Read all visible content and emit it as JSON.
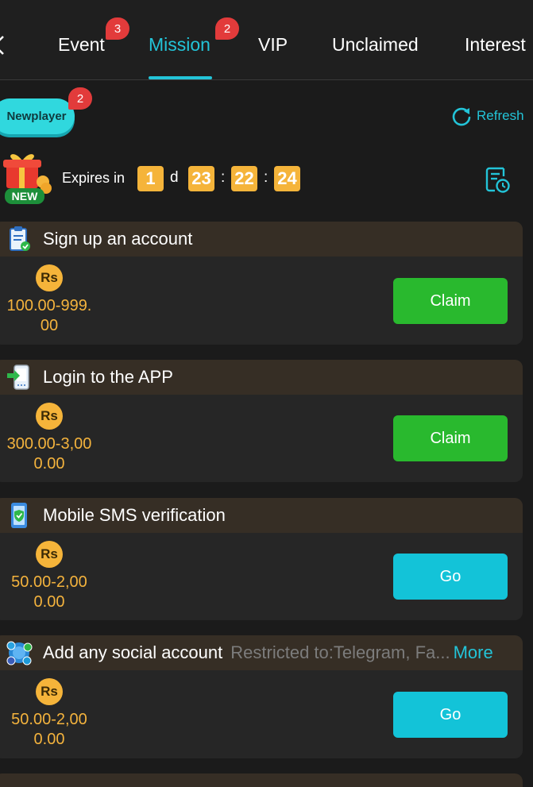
{
  "tabs": [
    {
      "label": "Event",
      "badge": "3",
      "active": false
    },
    {
      "label": "Mission",
      "badge": "2",
      "active": true
    },
    {
      "label": "VIP",
      "badge": "",
      "active": false
    },
    {
      "label": "Unclaimed",
      "badge": "",
      "active": false
    },
    {
      "label": "Interest",
      "badge": "",
      "active": false
    }
  ],
  "subheader": {
    "category_label": "Newplayer",
    "category_badge": "2",
    "refresh_label": "Refresh"
  },
  "countdown": {
    "label": "Expires in",
    "days": "1",
    "day_unit": "d",
    "hours": "23",
    "minutes": "22",
    "seconds": "24",
    "separator": ":",
    "gift_badge": "NEW"
  },
  "missions": [
    {
      "title": "Sign up an account",
      "restriction": "",
      "more": "",
      "currency": "Rs",
      "reward_line1": "100.00-999.",
      "reward_line2": "00",
      "action": "Claim",
      "icon": "clipboard-check-icon"
    },
    {
      "title": "Login to the APP",
      "restriction": "",
      "more": "",
      "currency": "Rs",
      "reward_line1": "300.00-3,00",
      "reward_line2": "0.00",
      "action": "Claim",
      "icon": "phone-login-icon"
    },
    {
      "title": "Mobile SMS verification",
      "restriction": "",
      "more": "",
      "currency": "Rs",
      "reward_line1": "50.00-2,00",
      "reward_line2": "0.00",
      "action": "Go",
      "icon": "phone-shield-icon"
    },
    {
      "title": "Add any social account",
      "restriction": "Restricted to:Telegram, Fa...",
      "more": "More",
      "currency": "Rs",
      "reward_line1": "50.00-2,00",
      "reward_line2": "0.00",
      "action": "Go",
      "icon": "social-network-icon"
    }
  ],
  "colors": {
    "accent": "#23c4d8",
    "claim_button": "#29b92e",
    "go_button": "#13c3d8",
    "reward_text": "#f4b33d",
    "badge": "#e23b3b"
  }
}
